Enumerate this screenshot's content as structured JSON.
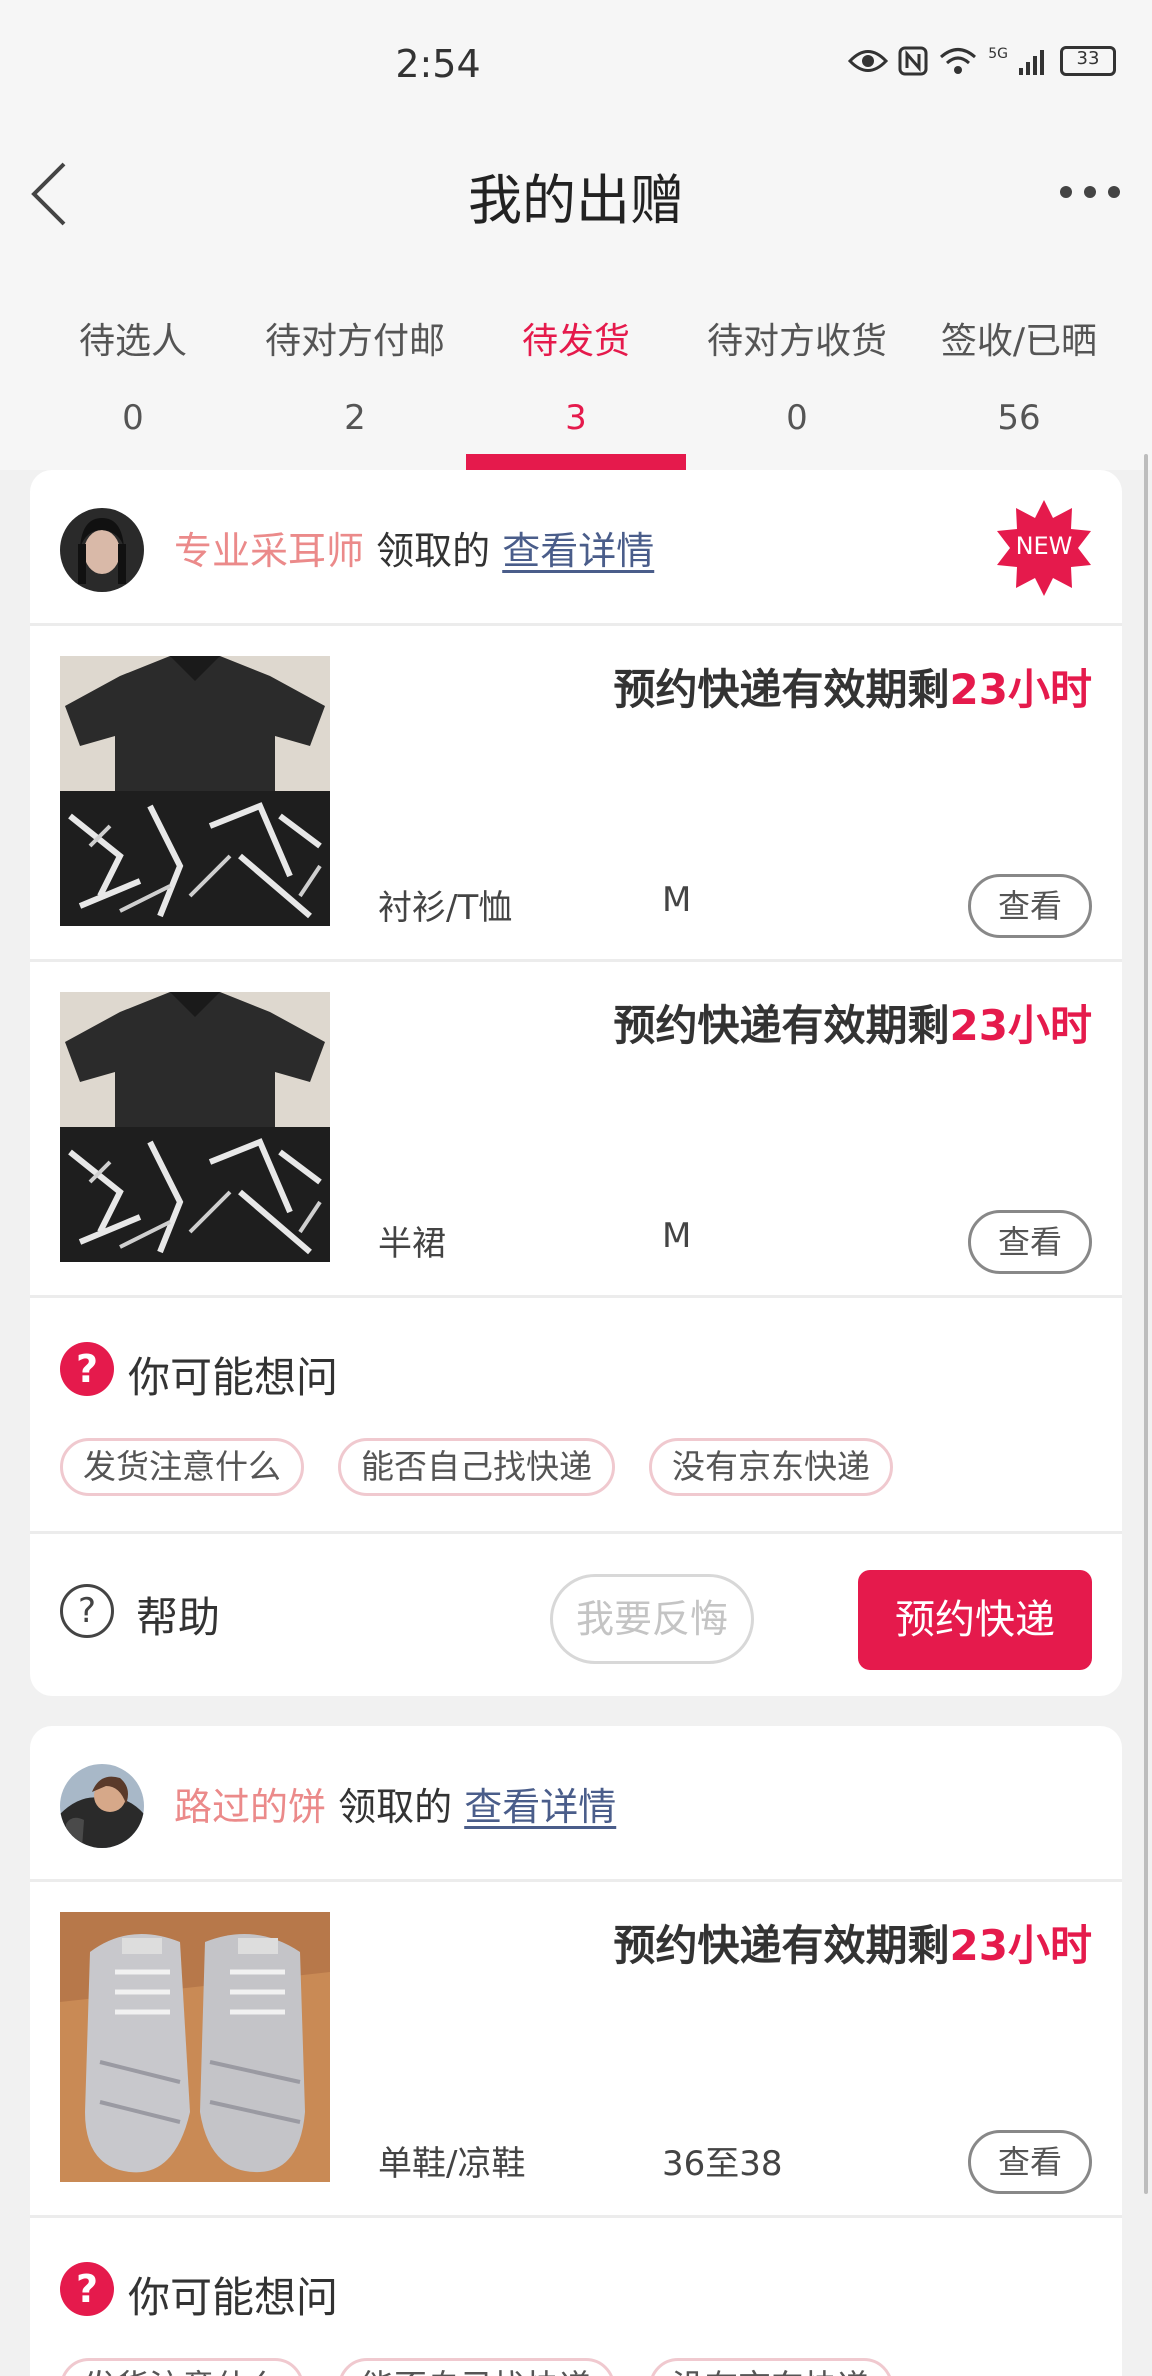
{
  "status_bar": {
    "time": "2:54",
    "network": "5G",
    "battery": "33",
    "icons": [
      "eye-icon",
      "nfc-icon",
      "wifi-icon",
      "signal-icon",
      "battery-icon"
    ]
  },
  "header": {
    "title": "我的出赠",
    "back_icon": "chevron-left-icon",
    "more_icon": "more-icon"
  },
  "tabs": [
    {
      "label": "待选人",
      "count": "0"
    },
    {
      "label": "待对方付邮",
      "count": "2"
    },
    {
      "label": "待发货",
      "count": "3",
      "active": true
    },
    {
      "label": "待对方收货",
      "count": "0"
    },
    {
      "label": "签收/已晒",
      "count": "56"
    }
  ],
  "cards": [
    {
      "user": "专业采耳师",
      "received": "领取的",
      "detail_link": "查看详情",
      "badge": "NEW",
      "items": [
        {
          "expiry_prefix": "预约快递有效期剩",
          "expiry_hours": "23小时",
          "category": "衬衫/T恤",
          "size": "M",
          "view_label": "查看"
        },
        {
          "expiry_prefix": "预约快递有效期剩",
          "expiry_hours": "23小时",
          "category": "半裙",
          "size": "M",
          "view_label": "查看"
        }
      ],
      "faq": {
        "title": "你可能想问",
        "chips": [
          "发货注意什么",
          "能否自己找快递",
          "没有京东快递"
        ]
      },
      "actions": {
        "help_label": "帮助",
        "regret_label": "我要反悔",
        "book_label": "预约快递"
      }
    },
    {
      "user": "路过的饼",
      "received": "领取的",
      "detail_link": "查看详情",
      "items": [
        {
          "expiry_prefix": "预约快递有效期剩",
          "expiry_hours": "23小时",
          "category": "单鞋/凉鞋",
          "size": "36至38",
          "view_label": "查看"
        }
      ],
      "faq": {
        "title": "你可能想问",
        "chips": [
          "发货注意什么",
          "能否自己找快递",
          "没有京东快递"
        ]
      }
    }
  ],
  "colors": {
    "accent": "#e51a4c",
    "username": "#eb8a8a",
    "link": "#4a5d8a"
  }
}
